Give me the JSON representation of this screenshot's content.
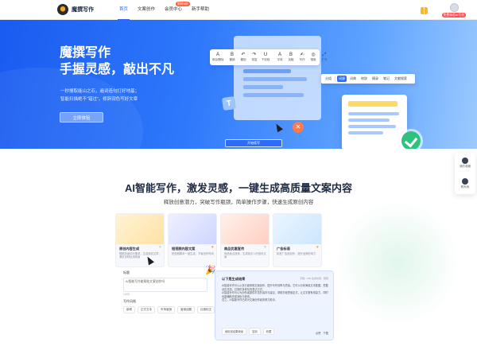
{
  "brand": {
    "name": "魔撰写作"
  },
  "nav": {
    "items": [
      {
        "label": "首页",
        "active": true
      },
      {
        "label": "文案创作",
        "active": false
      },
      {
        "label": "会员中心",
        "active": false,
        "badge": "限时5折"
      },
      {
        "label": "新手帮助",
        "active": false
      }
    ]
  },
  "user": {
    "tag": "免费体验AI写作"
  },
  "hero": {
    "title_line1": "魔撰写作",
    "title_line2": "手握灵感，敲出不凡",
    "desc_line1": "一秒搜取能山之石，遍词造句打好地基；",
    "desc_line2": "智能扫描绝不“错过”，修辞润色写好文章",
    "cta": "立即体验",
    "toolbar_main": [
      {
        "icon": "A",
        "label": "添加/删除"
      },
      {
        "icon": "B",
        "label": "撤销"
      },
      {
        "icon": "↶",
        "label": "撤回"
      },
      {
        "icon": "↷",
        "label": "恢复"
      },
      {
        "icon": "U",
        "label": "下划线"
      },
      {
        "icon": "A",
        "label": "字体"
      },
      {
        "icon": "B",
        "label": "加粗"
      },
      {
        "icon": "✍",
        "label": "写作"
      },
      {
        "icon": "◎",
        "label": "搜索"
      },
      {
        "icon": "⤢",
        "label": "扩写"
      }
    ],
    "toolbar_right": [
      {
        "label": "分组",
        "selected": false
      },
      {
        "label": "词源",
        "selected": true
      },
      {
        "label": "词典",
        "selected": false
      },
      {
        "label": "修辞",
        "selected": false
      },
      {
        "label": "摘录",
        "selected": false
      },
      {
        "label": "笔记",
        "selected": false
      },
      {
        "label": "文献搜索",
        "selected": false
      }
    ],
    "mini_button": "开始续写",
    "badge_letter": "T"
  },
  "side_panel": [
    {
      "label": "我的收藏"
    },
    {
      "label": "联系我"
    }
  ],
  "section": {
    "title": "AI智能写作，激发灵感，一键生成高质量文案内容",
    "subtitle": "释放创意潜力，突破写作瓶颈，简单操作步骤，快速生成原创内容"
  },
  "features": [
    {
      "name": "原创内容生成",
      "desc": "根据关键词与需求，生成原创文章，满足多种应用场景",
      "fav": false,
      "color": "#ffe8b8"
    },
    {
      "name": "短视频内容文案",
      "desc": "短视频脚本一键生成，节省创作时间",
      "fav": true,
      "color": "#e0e4ff"
    },
    {
      "name": "商品优惠宣传",
      "desc": "商品卖点提炼，生成吸引人的宣传文案",
      "fav": false,
      "color": "#ffe0d8"
    },
    {
      "name": "广告标语",
      "desc": "精准广告语创作，提升品牌影响力",
      "fav": true,
      "color": "#dff0ff"
    }
  ],
  "form": {
    "topic_label": "标题",
    "topic_value": "AI智能写作能帮助文案创作吗",
    "char_count": "14/20",
    "style_label": "写作风格",
    "styles": [
      "新闻",
      "正式文本",
      "市场营销",
      "营销话题",
      "社媒帖文"
    ]
  },
  "result": {
    "heading": "以下是生成结果",
    "meta": "字数：280 生成时间：刚刚",
    "paragraphs": [
      "AI智能写作可以从多方面帮助文案创作，提升写作效率与质量。它可以分析海量文本数据，挖掘创意灵感，并提供多样化的表达方式。",
      "AI智能写作可以为创作者提供丰富的素材与建议，帮助打破思维定式，让文字更有感染力，同时也能辅助完成润色与修改。",
      "总之，AI智能写作已成为文案创作者的得力助手。"
    ],
    "actions": [
      "使用该结果继续",
      "复制",
      "收藏"
    ],
    "right_actions": [
      "点赞",
      "下载"
    ]
  }
}
